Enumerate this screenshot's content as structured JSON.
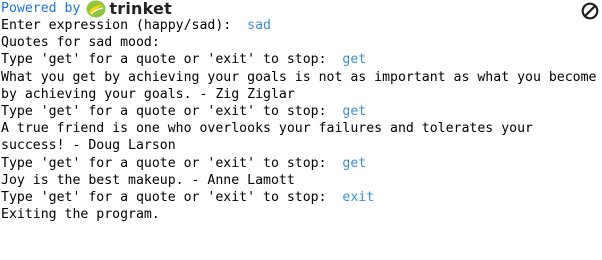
{
  "header": {
    "powered_by": "Powered by",
    "brand": "trinket",
    "logo_icon": "trinket-logo-icon",
    "stop_icon": "stop-icon"
  },
  "colors": {
    "powered_text": "#1a73e8",
    "user_input": "#3d8fd1",
    "logo_green": "#8dc63f",
    "logo_yellow": "#ffd200"
  },
  "console": {
    "lines": [
      {
        "prompt": "Enter expression (happy/sad):  ",
        "input": "sad"
      },
      {
        "prompt": "Quotes for sad mood:",
        "input": ""
      },
      {
        "prompt": "Type 'get' for a quote or 'exit' to stop:  ",
        "input": "get"
      },
      {
        "prompt": "What you get by achieving your goals is not as important as what you become",
        "input": ""
      },
      {
        "prompt": "by achieving your goals. - Zig Ziglar",
        "input": ""
      },
      {
        "prompt": "Type 'get' for a quote or 'exit' to stop:  ",
        "input": "get"
      },
      {
        "prompt": "A true friend is one who overlooks your failures and tolerates your",
        "input": ""
      },
      {
        "prompt": "success! - Doug Larson",
        "input": ""
      },
      {
        "prompt": "Type 'get' for a quote or 'exit' to stop:  ",
        "input": "get"
      },
      {
        "prompt": "Joy is the best makeup. - Anne Lamott",
        "input": ""
      },
      {
        "prompt": "Type 'get' for a quote or 'exit' to stop:  ",
        "input": "exit"
      },
      {
        "prompt": "Exiting the program.",
        "input": ""
      }
    ]
  }
}
